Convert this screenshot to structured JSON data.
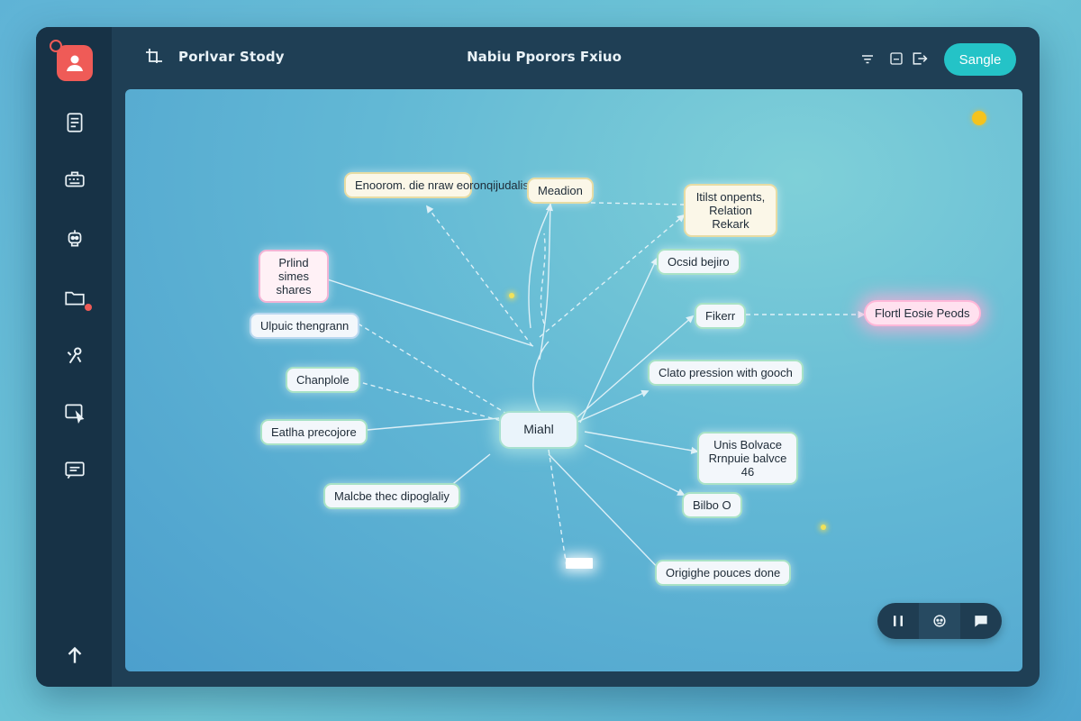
{
  "header": {
    "project_title": "Porlvar Stody",
    "center_title": "Nabiu Pporors Fxiuo",
    "primary_button": "Sangle"
  },
  "sidebar": {
    "items": [
      {
        "name": "documents",
        "icon": "document-icon"
      },
      {
        "name": "keyboard",
        "icon": "keyboard-icon"
      },
      {
        "name": "robot",
        "icon": "robot-icon"
      },
      {
        "name": "folder",
        "icon": "folder-icon"
      },
      {
        "name": "tools",
        "icon": "tools-icon"
      },
      {
        "name": "cursor",
        "icon": "pointer-icon"
      },
      {
        "name": "chat",
        "icon": "chat-icon"
      },
      {
        "name": "upload",
        "icon": "arrow-up-icon"
      }
    ]
  },
  "mindmap": {
    "center": "Miahl",
    "nodes": {
      "n1": "Enoorom. die nraw eoronqijudalis smuchars",
      "n2": "Meadion",
      "n3": "Itilst onpents, Relation Rekark",
      "n4": "Prlind simes shares",
      "n5": "Ocsid bejiro",
      "n6": "Ulpuic thengrann",
      "n7": "Fikerr",
      "n8": "Flortl Eosie Peods",
      "n9": "Chanplole",
      "n10": "Clato pression with gooch",
      "n11": "Eatlha precojore",
      "n12": "Unis Bolvace Rrnpuie balvce 46",
      "n13": "Malcbe thec dipoglaliy",
      "n14": "Bilbo O",
      "n15": "Origighe pouces done"
    }
  },
  "colors": {
    "frame": "#1f3f55",
    "sidebar": "#173246",
    "accent": "#24c3c7",
    "logo": "#ef5b57",
    "node_glow_pink": "#ffb7d8"
  }
}
